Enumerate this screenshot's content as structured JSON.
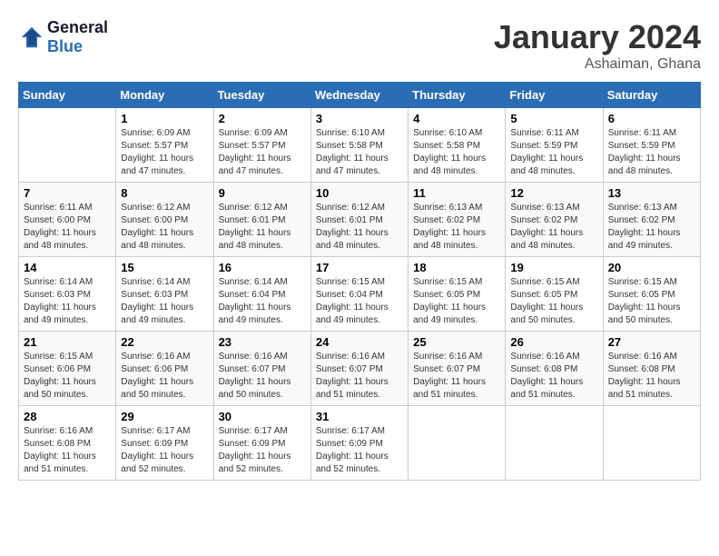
{
  "header": {
    "logo_line1": "General",
    "logo_line2": "Blue",
    "month": "January 2024",
    "location": "Ashaiman, Ghana"
  },
  "days_of_week": [
    "Sunday",
    "Monday",
    "Tuesday",
    "Wednesday",
    "Thursday",
    "Friday",
    "Saturday"
  ],
  "weeks": [
    [
      {
        "day": "",
        "info": ""
      },
      {
        "day": "1",
        "info": "Sunrise: 6:09 AM\nSunset: 5:57 PM\nDaylight: 11 hours\nand 47 minutes."
      },
      {
        "day": "2",
        "info": "Sunrise: 6:09 AM\nSunset: 5:57 PM\nDaylight: 11 hours\nand 47 minutes."
      },
      {
        "day": "3",
        "info": "Sunrise: 6:10 AM\nSunset: 5:58 PM\nDaylight: 11 hours\nand 47 minutes."
      },
      {
        "day": "4",
        "info": "Sunrise: 6:10 AM\nSunset: 5:58 PM\nDaylight: 11 hours\nand 48 minutes."
      },
      {
        "day": "5",
        "info": "Sunrise: 6:11 AM\nSunset: 5:59 PM\nDaylight: 11 hours\nand 48 minutes."
      },
      {
        "day": "6",
        "info": "Sunrise: 6:11 AM\nSunset: 5:59 PM\nDaylight: 11 hours\nand 48 minutes."
      }
    ],
    [
      {
        "day": "7",
        "info": "Sunrise: 6:11 AM\nSunset: 6:00 PM\nDaylight: 11 hours\nand 48 minutes."
      },
      {
        "day": "8",
        "info": "Sunrise: 6:12 AM\nSunset: 6:00 PM\nDaylight: 11 hours\nand 48 minutes."
      },
      {
        "day": "9",
        "info": "Sunrise: 6:12 AM\nSunset: 6:01 PM\nDaylight: 11 hours\nand 48 minutes."
      },
      {
        "day": "10",
        "info": "Sunrise: 6:12 AM\nSunset: 6:01 PM\nDaylight: 11 hours\nand 48 minutes."
      },
      {
        "day": "11",
        "info": "Sunrise: 6:13 AM\nSunset: 6:02 PM\nDaylight: 11 hours\nand 48 minutes."
      },
      {
        "day": "12",
        "info": "Sunrise: 6:13 AM\nSunset: 6:02 PM\nDaylight: 11 hours\nand 48 minutes."
      },
      {
        "day": "13",
        "info": "Sunrise: 6:13 AM\nSunset: 6:02 PM\nDaylight: 11 hours\nand 49 minutes."
      }
    ],
    [
      {
        "day": "14",
        "info": "Sunrise: 6:14 AM\nSunset: 6:03 PM\nDaylight: 11 hours\nand 49 minutes."
      },
      {
        "day": "15",
        "info": "Sunrise: 6:14 AM\nSunset: 6:03 PM\nDaylight: 11 hours\nand 49 minutes."
      },
      {
        "day": "16",
        "info": "Sunrise: 6:14 AM\nSunset: 6:04 PM\nDaylight: 11 hours\nand 49 minutes."
      },
      {
        "day": "17",
        "info": "Sunrise: 6:15 AM\nSunset: 6:04 PM\nDaylight: 11 hours\nand 49 minutes."
      },
      {
        "day": "18",
        "info": "Sunrise: 6:15 AM\nSunset: 6:05 PM\nDaylight: 11 hours\nand 49 minutes."
      },
      {
        "day": "19",
        "info": "Sunrise: 6:15 AM\nSunset: 6:05 PM\nDaylight: 11 hours\nand 50 minutes."
      },
      {
        "day": "20",
        "info": "Sunrise: 6:15 AM\nSunset: 6:05 PM\nDaylight: 11 hours\nand 50 minutes."
      }
    ],
    [
      {
        "day": "21",
        "info": "Sunrise: 6:15 AM\nSunset: 6:06 PM\nDaylight: 11 hours\nand 50 minutes."
      },
      {
        "day": "22",
        "info": "Sunrise: 6:16 AM\nSunset: 6:06 PM\nDaylight: 11 hours\nand 50 minutes."
      },
      {
        "day": "23",
        "info": "Sunrise: 6:16 AM\nSunset: 6:07 PM\nDaylight: 11 hours\nand 50 minutes."
      },
      {
        "day": "24",
        "info": "Sunrise: 6:16 AM\nSunset: 6:07 PM\nDaylight: 11 hours\nand 51 minutes."
      },
      {
        "day": "25",
        "info": "Sunrise: 6:16 AM\nSunset: 6:07 PM\nDaylight: 11 hours\nand 51 minutes."
      },
      {
        "day": "26",
        "info": "Sunrise: 6:16 AM\nSunset: 6:08 PM\nDaylight: 11 hours\nand 51 minutes."
      },
      {
        "day": "27",
        "info": "Sunrise: 6:16 AM\nSunset: 6:08 PM\nDaylight: 11 hours\nand 51 minutes."
      }
    ],
    [
      {
        "day": "28",
        "info": "Sunrise: 6:16 AM\nSunset: 6:08 PM\nDaylight: 11 hours\nand 51 minutes."
      },
      {
        "day": "29",
        "info": "Sunrise: 6:17 AM\nSunset: 6:09 PM\nDaylight: 11 hours\nand 52 minutes."
      },
      {
        "day": "30",
        "info": "Sunrise: 6:17 AM\nSunset: 6:09 PM\nDaylight: 11 hours\nand 52 minutes."
      },
      {
        "day": "31",
        "info": "Sunrise: 6:17 AM\nSunset: 6:09 PM\nDaylight: 11 hours\nand 52 minutes."
      },
      {
        "day": "",
        "info": ""
      },
      {
        "day": "",
        "info": ""
      },
      {
        "day": "",
        "info": ""
      }
    ]
  ]
}
